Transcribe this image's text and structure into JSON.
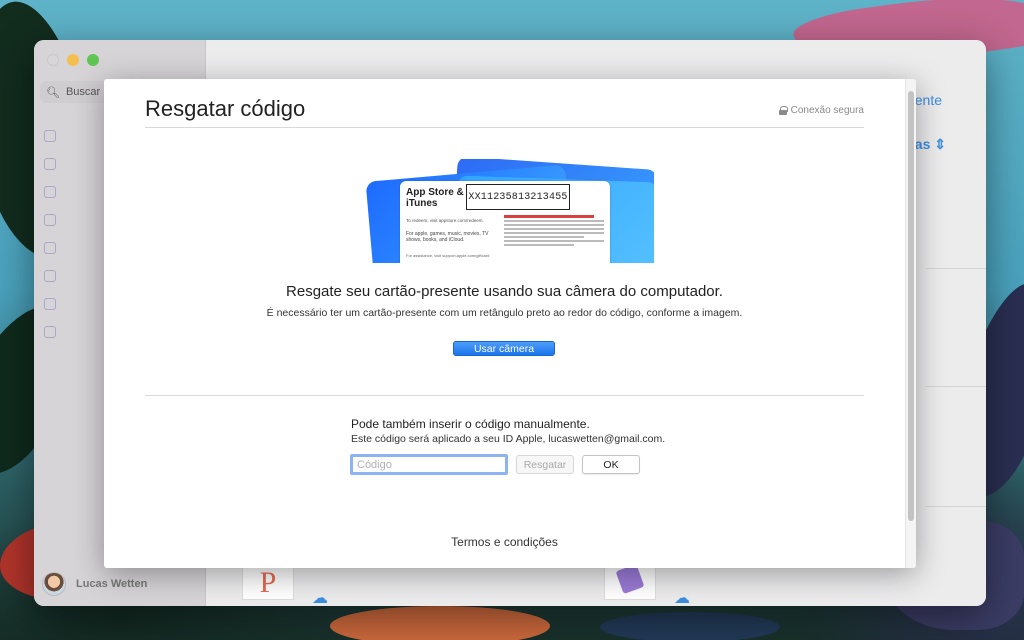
{
  "app": {
    "sidebar": {
      "search_placeholder": "Buscar",
      "user_name": "Lucas Wetten"
    },
    "main": {
      "right_link": "ente",
      "right_sort": "as"
    }
  },
  "dialog": {
    "title": "Resgatar código",
    "secure_label": "Conexão segura",
    "gift_card": {
      "brand": "App Store & iTunes",
      "code": "XX11235813213455",
      "redeem_text": "To redeem, visit appstore.com/redeem.",
      "uses_text": "For apple, games, music, movies, TV shows, books, and iCloud.",
      "assistance_text": "For assistance, visit support.apple.com/giftcard"
    },
    "camera_section": {
      "headline": "Resgate seu cartão-presente usando sua câmera do computador.",
      "subline": "É necessário ter um cartão-presente com um retângulo preto ao redor do código, conforme a imagem.",
      "button_label": "Usar câmera"
    },
    "manual_section": {
      "title": "Pode também inserir o código manualmente.",
      "subtitle": "Este código será aplicado a seu ID Apple, lucaswetten@gmail.com.",
      "input_value": "",
      "input_placeholder": "Código",
      "redeem_button": "Resgatar",
      "ok_button": "OK"
    },
    "terms_link": "Termos e condições"
  },
  "colors": {
    "accent": "#1b76ec",
    "focus_ring": "#8cb4f2"
  }
}
